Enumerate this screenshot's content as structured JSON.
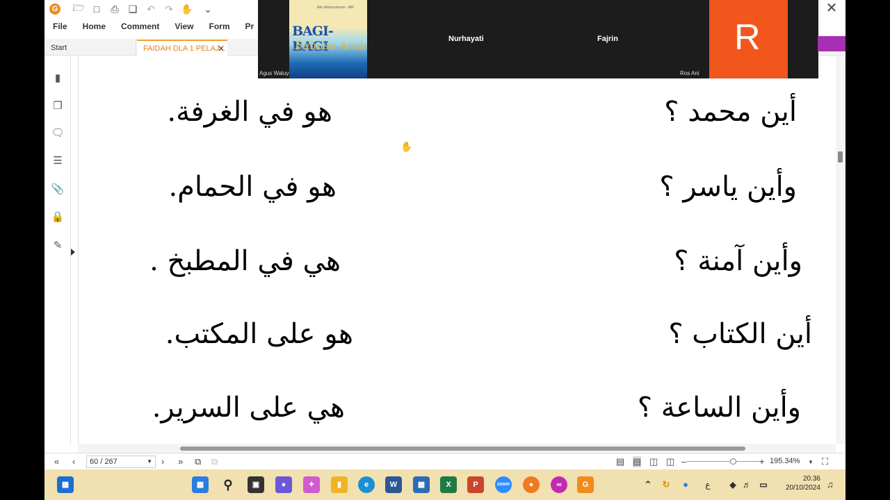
{
  "menu": {
    "items": [
      "File",
      "Home",
      "Comment",
      "View",
      "Form",
      "Pr"
    ]
  },
  "tabs": {
    "start": "Start",
    "document": "FAIDAH DLA 1 PELAJ..."
  },
  "content": {
    "lines": [
      {
        "question": "أين محمد ؟",
        "answer": "هو في الغرفة."
      },
      {
        "question": "وأين ياسر ؟",
        "answer": "هو في الحمام."
      },
      {
        "question": "وأين آمنة ؟",
        "answer": "هي في المطبخ ."
      },
      {
        "question": "أين الكتاب ؟",
        "answer": "هو على المكتب."
      },
      {
        "question": "وأين الساعة ؟",
        "answer": "هي على السرير."
      }
    ]
  },
  "status": {
    "page": "60 / 267",
    "zoom": "195.34%"
  },
  "video": {
    "participant_thumb_title": "BAGI-BAGI",
    "participant_thumb_sub": "Bahasa Arab",
    "participant_thumb_tiny": "Abu Abdurrahman - ABI",
    "participant1": "Agus Waluyo",
    "participant2": "Nurhayati",
    "participant3": "Fajrin",
    "participant4": "Ros Ani",
    "avatar_letter": "R"
  },
  "taskbar": {
    "time": "20.36",
    "date": "20/10/2024",
    "ime": "ع"
  }
}
